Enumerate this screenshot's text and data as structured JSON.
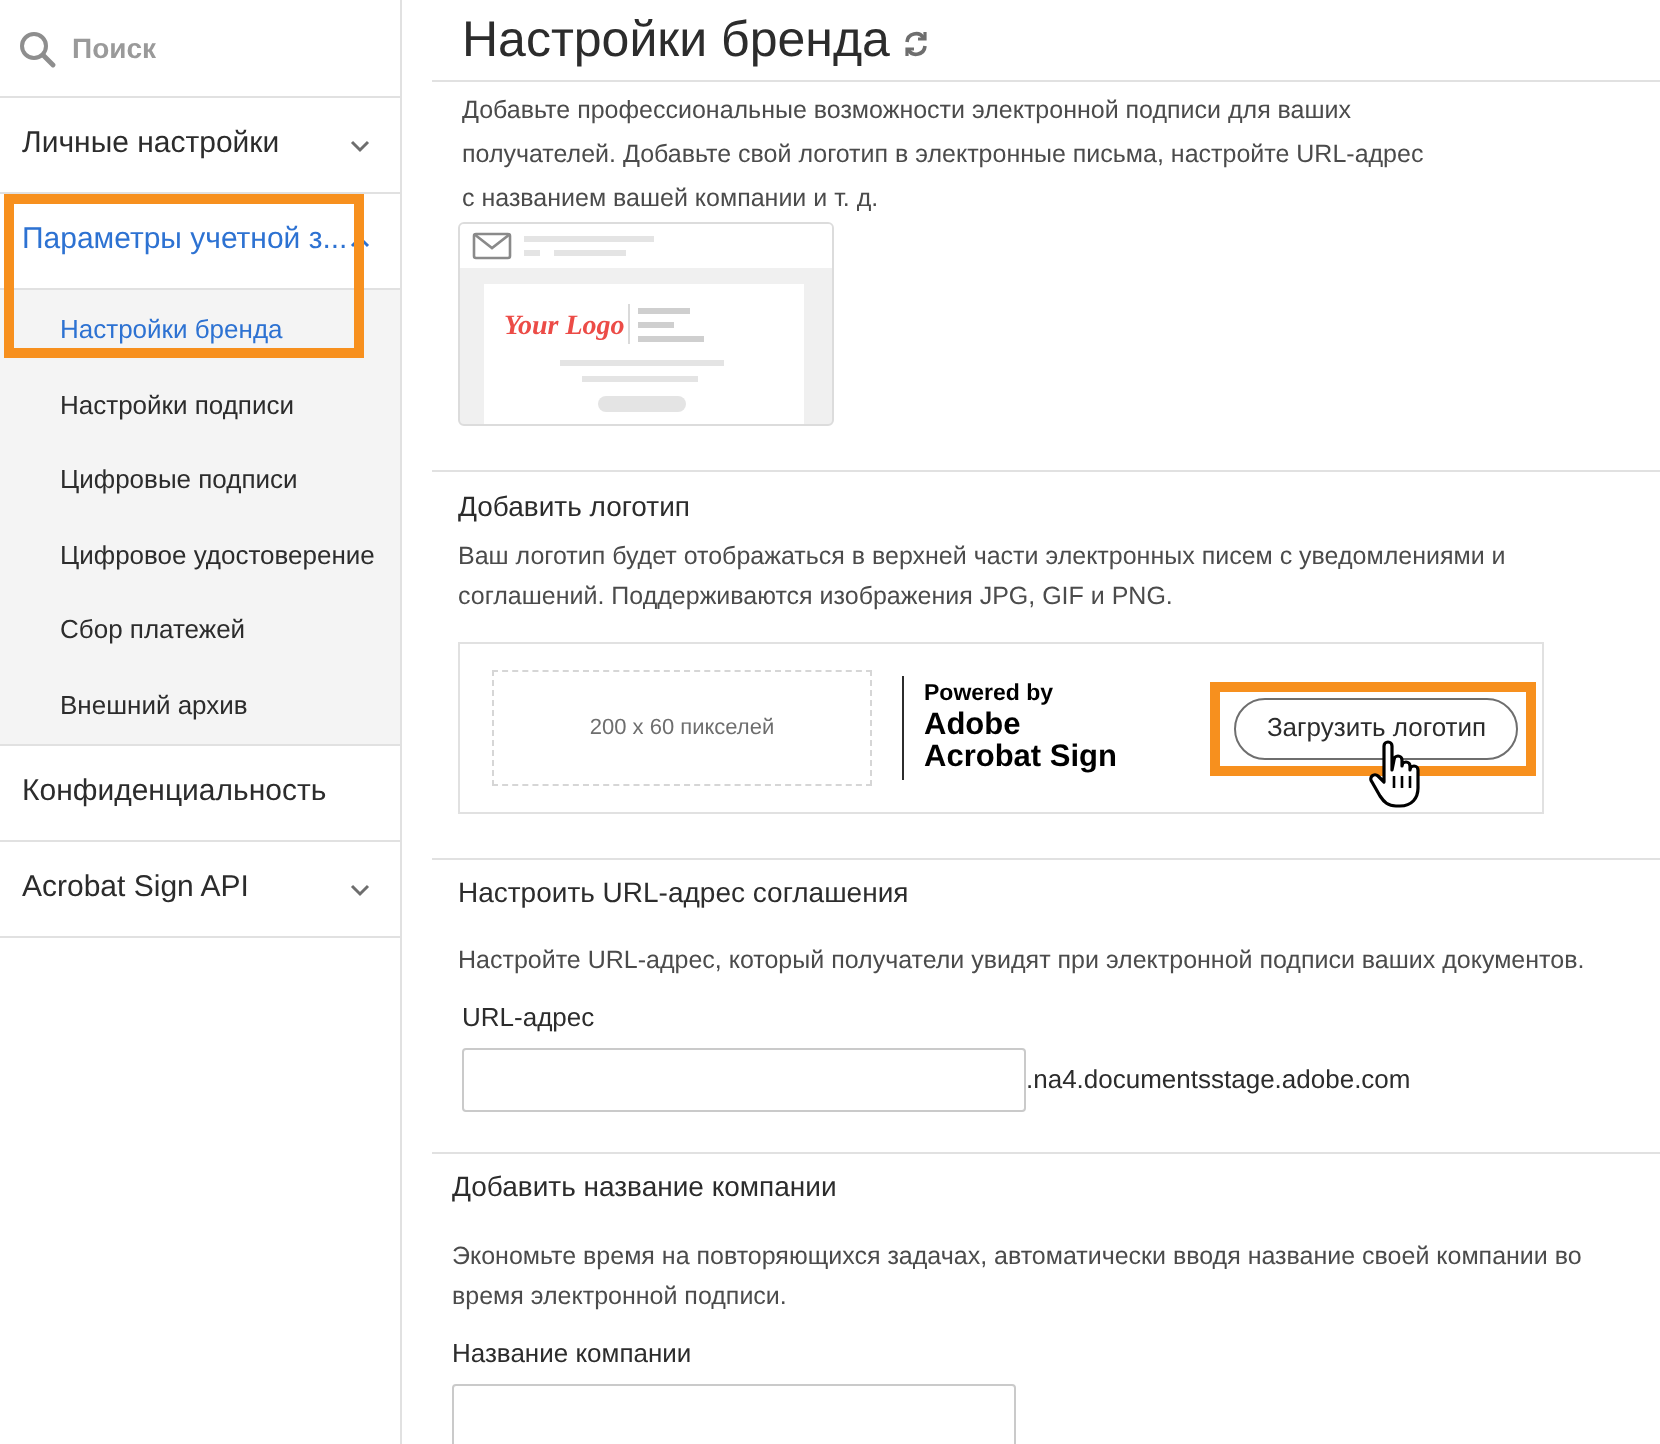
{
  "sidebar": {
    "search": {
      "placeholder": "Поиск"
    },
    "items": [
      {
        "label": "Личные настройки",
        "kind": "group",
        "expanded": false,
        "selected": false,
        "callout": false
      },
      {
        "label": "Параметры учетной з...",
        "kind": "group",
        "expanded": true,
        "selected": true,
        "callout": true,
        "children": [
          {
            "label": "Настройки бренда",
            "selected": true
          },
          {
            "label": "Настройки подписи",
            "selected": false
          },
          {
            "label": "Цифровые подписи",
            "selected": false
          },
          {
            "label": "Цифровое удостоверение",
            "selected": false
          },
          {
            "label": "Сбор платежей",
            "selected": false
          },
          {
            "label": "Внешний архив",
            "selected": false
          }
        ]
      },
      {
        "label": "Конфиденциальность",
        "kind": "link",
        "selected": false,
        "callout": false
      },
      {
        "label": "Acrobat Sign API",
        "kind": "group",
        "expanded": false,
        "selected": false,
        "callout": false
      }
    ]
  },
  "page": {
    "title": "Настройки бренда",
    "intro": "Добавьте профессиональные возможности электронной подписи для ваших получателей. Добавьте свой логотип в электронные письма, настройте URL-адрес с названием вашей компании и т. д.",
    "illustration_logo": "Your Logo",
    "logo_section": {
      "heading": "Добавить логотип",
      "description": "Ваш логотип будет отображаться в верхней части электронных писем с уведомлениями и соглашений. Поддерживаются изображения JPG, GIF и PNG.",
      "placeholder_size": "200 x 60 пикселей",
      "powered_by": "Powered by",
      "brand_line_1": "Adobe",
      "brand_line_2": "Acrobat Sign",
      "upload_button": {
        "label": "Загрузить логотип",
        "callout": true
      }
    },
    "url_section": {
      "heading": "Настроить URL-адрес соглашения",
      "description": "Настройте URL-адрес, который получатели увидят при электронной подписи ваших документов.",
      "field_label": "URL-адрес",
      "domain_suffix": ".na4.documentsstage.adobe.com"
    },
    "company_section": {
      "heading": "Добавить название компании",
      "description": "Экономьте время на повторяющихся задачах, автоматически вводя название своей компании во время электронной подписи.",
      "field_label": "Название компании"
    }
  }
}
